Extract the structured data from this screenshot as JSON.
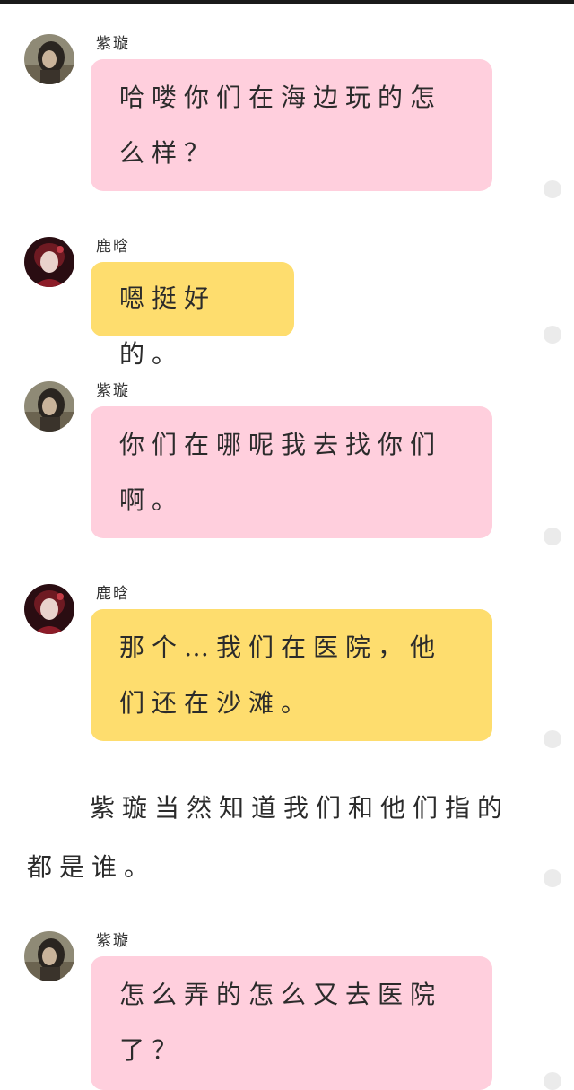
{
  "messages": [
    {
      "sender": "紫璇",
      "text": "哈喽你们在海边玩的怎么样？",
      "color": "#ffcfdd",
      "avatar": "girl-dark-avatar"
    },
    {
      "sender": "鹿晗",
      "text": "嗯挺好的。",
      "color": "#fedd6e",
      "avatar": "boy-red-avatar"
    },
    {
      "sender": "紫璇",
      "text": "你们在哪呢我去找你们啊。",
      "color": "#ffcfdd",
      "avatar": "girl-dark-avatar"
    },
    {
      "sender": "鹿晗",
      "text": "那个…我们在医院，他们还在沙滩。",
      "color": "#fedd6e",
      "avatar": "boy-red-avatar"
    },
    {
      "sender": "紫璇",
      "text": "怎么弄的怎么又去医院了？",
      "color": "#ffcfdd",
      "avatar": "girl-dark-avatar"
    }
  ],
  "narration": "紫璇当然知道我们和他们指的都是谁。"
}
